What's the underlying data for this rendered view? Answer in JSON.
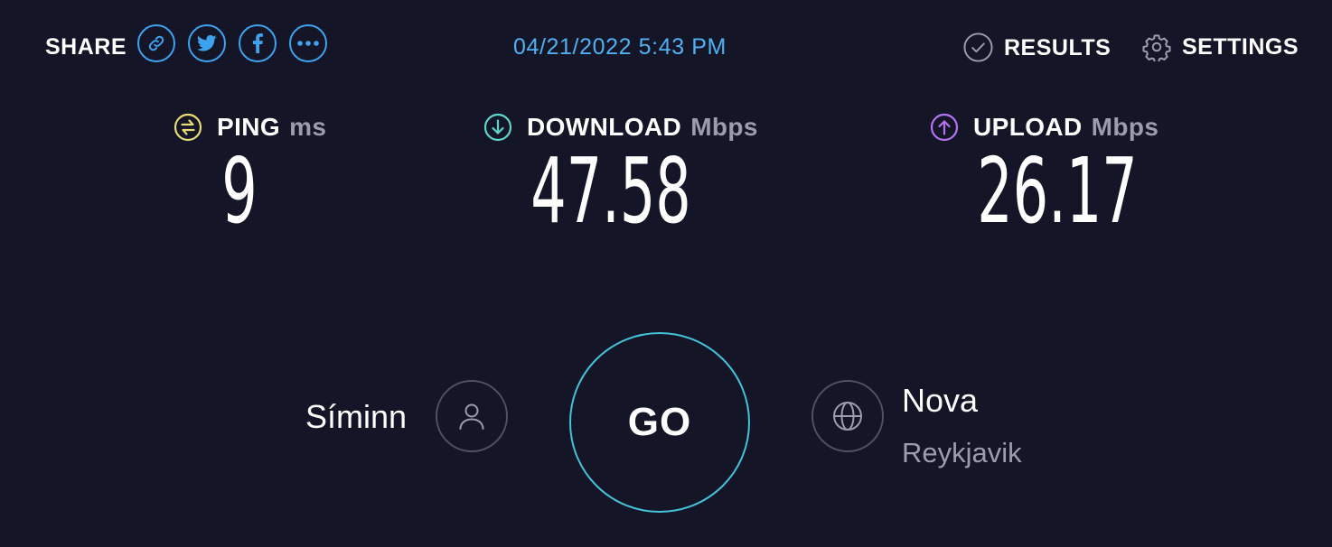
{
  "header": {
    "share_label": "SHARE",
    "share_buttons": [
      {
        "icon": "link-icon"
      },
      {
        "icon": "twitter-icon"
      },
      {
        "icon": "facebook-icon"
      },
      {
        "icon": "more-icon"
      }
    ],
    "datetime": "04/21/2022 5:43 PM",
    "results_label": "RESULTS",
    "settings_label": "SETTINGS"
  },
  "metrics": {
    "ping": {
      "label": "PING",
      "unit": "ms",
      "value": "9",
      "icon": "ping-icon",
      "color": "#e6db74"
    },
    "download": {
      "label": "DOWNLOAD",
      "unit": "Mbps",
      "value": "47.58",
      "icon": "download-arrow-icon",
      "color": "#5fd5c9"
    },
    "upload": {
      "label": "UPLOAD",
      "unit": "Mbps",
      "value": "26.17",
      "icon": "upload-arrow-icon",
      "color": "#b473f2"
    }
  },
  "isp": {
    "name": "Síminn",
    "icon": "user-icon"
  },
  "go_label": "GO",
  "server": {
    "name": "Nova",
    "location": "Reykjavik",
    "icon": "globe-icon"
  },
  "colors": {
    "background": "#141526",
    "accent_blue": "#3ea2ef",
    "go_ring": "#44c3d9",
    "muted_text": "#9b9cac"
  }
}
